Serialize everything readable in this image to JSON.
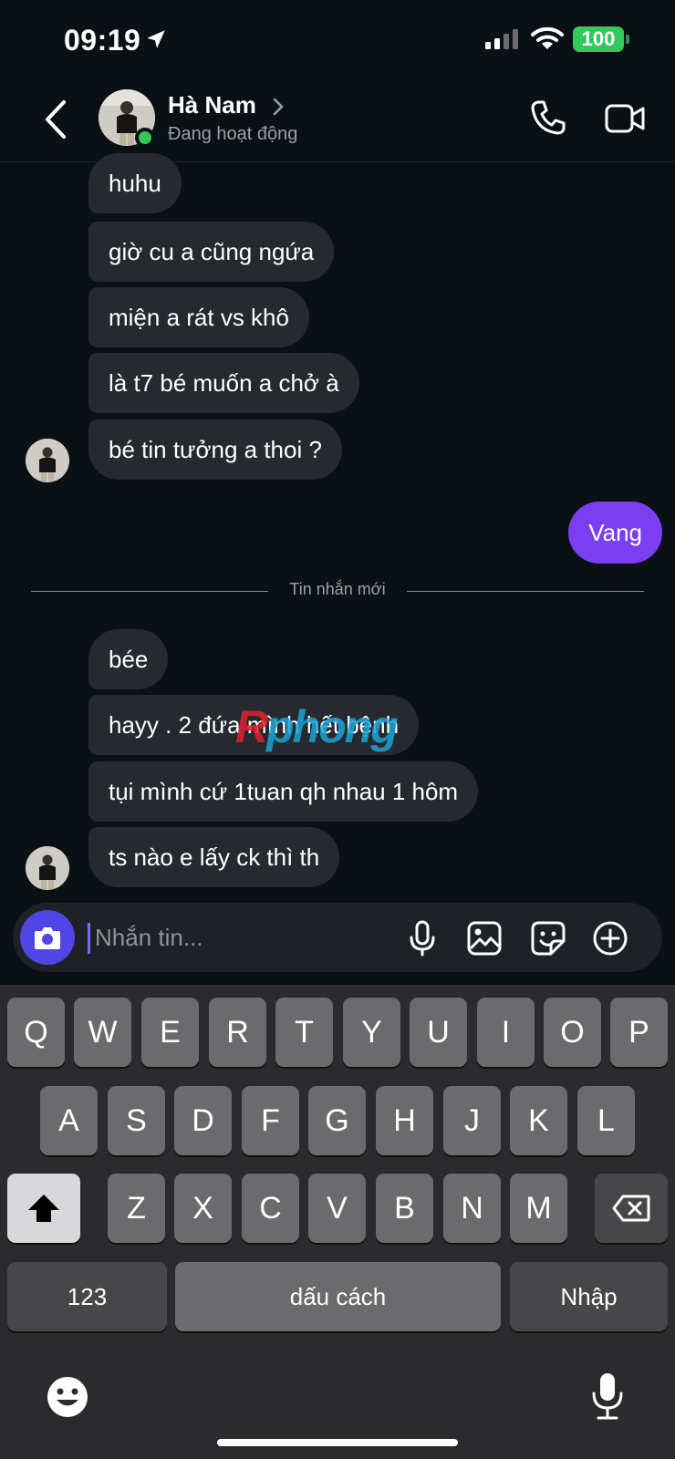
{
  "status_bar": {
    "time": "09:19",
    "battery": "100"
  },
  "header": {
    "name": "Hà Nam",
    "status": "Đang hoạt động"
  },
  "messages_group1": [
    "huhu",
    "giờ cu a cũng ngứa",
    "miện a rát vs khô",
    "là t7 bé muốn a chở à",
    "bé tin tưởng a thoi ?"
  ],
  "my_message": "Vang",
  "divider_label": "Tin nhắn mới",
  "messages_group2": [
    "bée",
    "hayy . 2 đứa mình hết bệnh",
    "tụi mình cứ 1tuan qh nhau 1 hôm",
    "ts nào e lấy ck thì th"
  ],
  "watermark": {
    "part1": "R",
    "part2": "phong"
  },
  "composer": {
    "placeholder": "Nhắn tin..."
  },
  "keyboard": {
    "row1": [
      "Q",
      "W",
      "E",
      "R",
      "T",
      "Y",
      "U",
      "I",
      "O",
      "P"
    ],
    "row2": [
      "A",
      "S",
      "D",
      "F",
      "G",
      "H",
      "J",
      "K",
      "L"
    ],
    "row3": [
      "Z",
      "X",
      "C",
      "V",
      "B",
      "N",
      "M"
    ],
    "numbers": "123",
    "space": "dấu cách",
    "enter": "Nhập"
  },
  "colors": {
    "accent": "#7b3ff2",
    "camera": "#4f46e5",
    "online": "#34c759",
    "bubble": "#262a2f"
  }
}
